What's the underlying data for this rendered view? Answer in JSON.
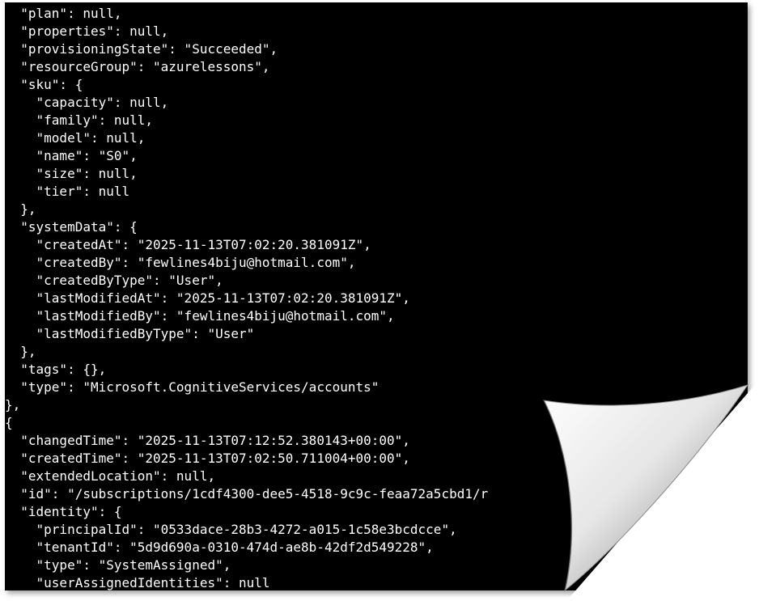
{
  "terminal": {
    "lines": [
      "  \"plan\": null,",
      "  \"properties\": null,",
      "  \"provisioningState\": \"Succeeded\",",
      "  \"resourceGroup\": \"azurelessons\",",
      "  \"sku\": {",
      "    \"capacity\": null,",
      "    \"family\": null,",
      "    \"model\": null,",
      "    \"name\": \"S0\",",
      "    \"size\": null,",
      "    \"tier\": null",
      "  },",
      "  \"systemData\": {",
      "    \"createdAt\": \"2025-11-13T07:02:20.381091Z\",",
      "    \"createdBy\": \"fewlines4biju@hotmail.com\",",
      "    \"createdByType\": \"User\",",
      "    \"lastModifiedAt\": \"2025-11-13T07:02:20.381091Z\",",
      "    \"lastModifiedBy\": \"fewlines4biju@hotmail.com\",",
      "    \"lastModifiedByType\": \"User\"",
      "  },",
      "  \"tags\": {},",
      "  \"type\": \"Microsoft.CognitiveServices/accounts\"",
      "},",
      "{",
      "  \"changedTime\": \"2025-11-13T07:12:52.380143+00:00\",",
      "  \"createdTime\": \"2025-11-13T07:02:50.711004+00:00\",",
      "  \"extendedLocation\": null,",
      "  \"id\": \"/subscriptions/1cdf4300-dee5-4518-9c9c-feaa72a5cbd1/r",
      "  \"identity\": {",
      "    \"principalId\": \"0533dace-28b3-4272-a015-1c58e3bcdcce\",",
      "    \"tenantId\": \"5d9d690a-0310-474d-ae8b-42df2d549228\",",
      "    \"type\": \"SystemAssigned\",",
      "    \"userAssignedIdentities\": null"
    ]
  },
  "colors": {
    "background": "#000000",
    "text": "#ffffff",
    "page": "#ffffff"
  },
  "decoration": {
    "corner": "page-curl-icon"
  }
}
